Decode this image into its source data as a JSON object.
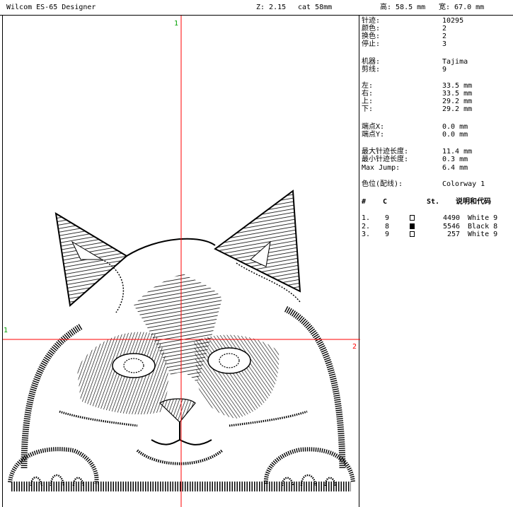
{
  "header": {
    "app_title": "Wilcom ES-65 Designer",
    "zoom": "Z: 2.15",
    "design_name": "cat 58mm",
    "height": "高: 58.5 mm",
    "width": "宽: 67.0 mm"
  },
  "canvas": {
    "markers": {
      "top": "1",
      "left": "1",
      "right": "2"
    },
    "accent_color": "#ff0000"
  },
  "info": {
    "stitches": {
      "label": "针迹:",
      "value": "10295"
    },
    "colors": {
      "label": "颜色:",
      "value": "2"
    },
    "color_changes": {
      "label": "换色:",
      "value": "2"
    },
    "stops": {
      "label": "停止:",
      "value": "3"
    },
    "machine": {
      "label": "机器:",
      "value": "Tajima"
    },
    "trims": {
      "label": "剪线:",
      "value": "9"
    },
    "left": {
      "label": "左:",
      "value": "33.5 mm"
    },
    "right": {
      "label": "右:",
      "value": "33.5 mm"
    },
    "up": {
      "label": "上:",
      "value": "29.2 mm"
    },
    "down": {
      "label": "下:",
      "value": "29.2 mm"
    },
    "end_x": {
      "label": "端点X:",
      "value": "0.0 mm"
    },
    "end_y": {
      "label": "端点Y:",
      "value": "0.0 mm"
    },
    "max_stitch": {
      "label": "最大针迹长度:",
      "value": "11.4 mm"
    },
    "min_stitch": {
      "label": "最小针迹长度:",
      "value": "0.3 mm"
    },
    "max_jump": {
      "label": "Max Jump:",
      "value": "6.4 mm"
    },
    "colorway": {
      "label": "色位(配线):",
      "value": "Colorway 1"
    }
  },
  "table": {
    "headers": {
      "num": "#",
      "c": "C",
      "st": "St.",
      "desc": "说明和代码"
    },
    "rows": [
      {
        "num": "1.",
        "c": "9",
        "swatch": "#ffffff",
        "st": "4490",
        "desc": "White 9"
      },
      {
        "num": "2.",
        "c": "8",
        "swatch": "#000000",
        "st": "5546",
        "desc": "Black 8"
      },
      {
        "num": "3.",
        "c": "9",
        "swatch": "#ffffff",
        "st": "257",
        "desc": "White 9"
      }
    ]
  }
}
